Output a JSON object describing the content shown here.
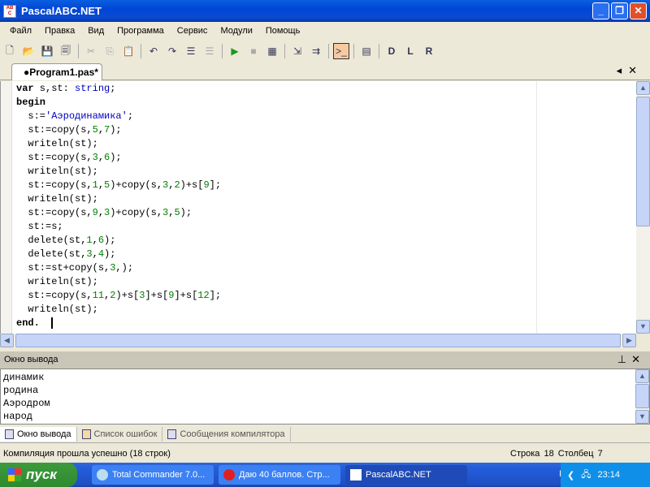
{
  "window": {
    "title": "PascalABC.NET"
  },
  "menu": [
    "Файл",
    "Правка",
    "Вид",
    "Программа",
    "Сервис",
    "Модули",
    "Помощь"
  ],
  "toolbar": [
    "new-file",
    "open",
    "save",
    "save-all",
    "cut",
    "copy",
    "paste",
    "undo",
    "redo",
    "format",
    "unformat",
    "run",
    "stop",
    "debug",
    "step-into",
    "step-over",
    "output-window",
    "properties",
    "module-d",
    "module-l",
    "module-r"
  ],
  "tab": {
    "label": "●Program1.pas*"
  },
  "code": [
    [
      [
        "var",
        "k"
      ],
      [
        " s,st: ",
        ""
      ],
      [
        "string",
        "t"
      ],
      [
        ";",
        ""
      ]
    ],
    [
      [
        "begin",
        "k"
      ]
    ],
    [
      [
        "  s:=",
        ""
      ],
      [
        "'Аэродинамика'",
        "s"
      ],
      [
        ";",
        ""
      ]
    ],
    [
      [
        "  st:=copy(s,",
        ""
      ],
      [
        "5",
        "n"
      ],
      [
        ",",
        ""
      ],
      [
        "7",
        "n"
      ],
      [
        ");",
        ""
      ]
    ],
    [
      [
        "  writeln(st);",
        ""
      ]
    ],
    [
      [
        "  st:=copy(s,",
        ""
      ],
      [
        "3",
        "n"
      ],
      [
        ",",
        ""
      ],
      [
        "6",
        "n"
      ],
      [
        ");",
        ""
      ]
    ],
    [
      [
        "  writeln(st);",
        ""
      ]
    ],
    [
      [
        "  st:=copy(s,",
        ""
      ],
      [
        "1",
        "n"
      ],
      [
        ",",
        ""
      ],
      [
        "5",
        "n"
      ],
      [
        ")+copy(s,",
        ""
      ],
      [
        "3",
        "n"
      ],
      [
        ",",
        ""
      ],
      [
        "2",
        "n"
      ],
      [
        ")+s[",
        ""
      ],
      [
        "9",
        "n"
      ],
      [
        "];",
        ""
      ]
    ],
    [
      [
        "  writeln(st);",
        ""
      ]
    ],
    [
      [
        "  st:=copy(s,",
        ""
      ],
      [
        "9",
        "n"
      ],
      [
        ",",
        ""
      ],
      [
        "3",
        "n"
      ],
      [
        ")+copy(s,",
        ""
      ],
      [
        "3",
        "n"
      ],
      [
        ",",
        ""
      ],
      [
        "5",
        "n"
      ],
      [
        ");",
        ""
      ]
    ],
    [
      [
        "  st:=s;",
        ""
      ]
    ],
    [
      [
        "  delete(st,",
        ""
      ],
      [
        "1",
        "n"
      ],
      [
        ",",
        ""
      ],
      [
        "6",
        "n"
      ],
      [
        ");",
        ""
      ]
    ],
    [
      [
        "  delete(st,",
        ""
      ],
      [
        "3",
        "n"
      ],
      [
        ",",
        ""
      ],
      [
        "4",
        "n"
      ],
      [
        ");",
        ""
      ]
    ],
    [
      [
        "  st:=st+copy(s,",
        ""
      ],
      [
        "3",
        "n"
      ],
      [
        ",);",
        ""
      ]
    ],
    [
      [
        "  writeln(st);",
        ""
      ]
    ],
    [
      [
        "  st:=copy(s,",
        ""
      ],
      [
        "11",
        "n"
      ],
      [
        ",",
        ""
      ],
      [
        "2",
        "n"
      ],
      [
        ")+s[",
        ""
      ],
      [
        "3",
        "n"
      ],
      [
        "]+s[",
        ""
      ],
      [
        "9",
        "n"
      ],
      [
        "]+s[",
        ""
      ],
      [
        "12",
        "n"
      ],
      [
        "];",
        ""
      ]
    ],
    [
      [
        "  writeln(st);",
        ""
      ]
    ],
    [
      [
        "end.",
        "k"
      ],
      [
        "  ",
        ""
      ]
    ]
  ],
  "output": {
    "title": "Окно вывода",
    "lines": [
      "динамик",
      "родина",
      "Аэродром",
      "народ"
    ]
  },
  "bottom_tabs": [
    "Окно вывода",
    "Список ошибок",
    "Сообщения компилятора"
  ],
  "status": {
    "message": "Компиляция прошла успешно (18 строк)",
    "row_label": "Строка",
    "row": "18",
    "col_label": "Столбец",
    "col": "7"
  },
  "taskbar": {
    "start": "пуск",
    "tasks": [
      "Total Commander 7.0...",
      "Даю 40 баллов. Стр...",
      "PascalABC.NET"
    ],
    "lang": "RU",
    "clock": "23:14"
  }
}
